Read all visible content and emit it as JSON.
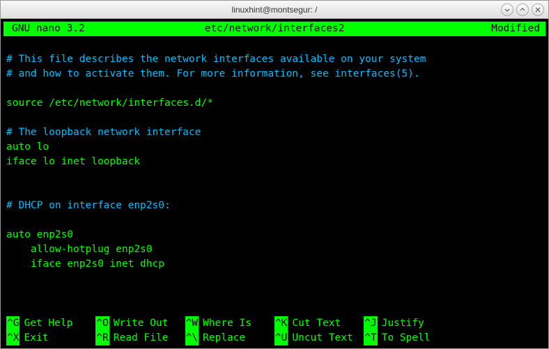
{
  "window": {
    "title": "linuxhint@montsegur: /"
  },
  "editor": {
    "name": "GNU nano 3.2",
    "file": "etc/network/interfaces2",
    "status": "Modified"
  },
  "content": {
    "line1": "# This file describes the network interfaces available on your system",
    "line2": "# and how to activate them. For more information, see interfaces(5).",
    "line3": "source /etc/network/interfaces.d/*",
    "line4": "# The loopback network interface",
    "line5": "auto lo",
    "line6": "iface lo inet loopback",
    "line7": "# DHCP on interface enp2s0:",
    "line8": "auto enp2s0",
    "line9": "    allow-hotplug enp2s0",
    "line10": "    iface enp2s0 inet dhcp"
  },
  "shortcuts": {
    "row1": [
      {
        "key": "^G",
        "desc": "Get Help"
      },
      {
        "key": "^O",
        "desc": "Write Out"
      },
      {
        "key": "^W",
        "desc": "Where Is"
      },
      {
        "key": "^K",
        "desc": "Cut Text"
      },
      {
        "key": "^J",
        "desc": "Justify"
      }
    ],
    "row2": [
      {
        "key": "^X",
        "desc": "Exit"
      },
      {
        "key": "^R",
        "desc": "Read File"
      },
      {
        "key": "^\\",
        "desc": "Replace"
      },
      {
        "key": "^U",
        "desc": "Uncut Text"
      },
      {
        "key": "^T",
        "desc": "To Spell"
      }
    ]
  }
}
